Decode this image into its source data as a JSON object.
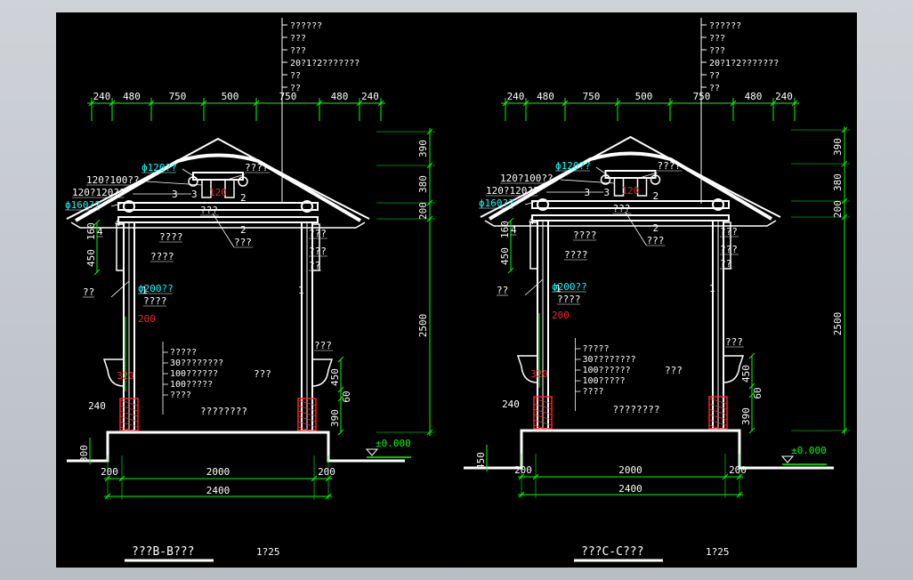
{
  "colors": {
    "background": "#000000",
    "frame": "#c4c8cd",
    "line": "#ffffff",
    "dimension": "#00ff00",
    "dim_text": "#ffffff",
    "red": "#ff2020",
    "cyan": "#00ffff",
    "yellow": "#ffff00"
  },
  "left": {
    "title": "???B-B???",
    "scale": "1?25",
    "top_dims": [
      "240",
      "480",
      "750",
      "500",
      "750",
      "480",
      "240"
    ],
    "bottom_dims": [
      "200",
      "2000",
      "200"
    ],
    "bottom_total": "2400",
    "right_dims": [
      "390",
      "380",
      "200",
      "2500"
    ],
    "left_dims": [
      "450",
      "160",
      "300",
      "240",
      "320"
    ],
    "mid_dims": [
      "200"
    ],
    "elev": "±0.000",
    "roof_notes": [
      "??????",
      "???",
      "???",
      "20?1?2???????",
      "??",
      "??"
    ],
    "labels_left": [
      "ϕ120??",
      "120?100??",
      "120?120??",
      "ϕ160??",
      "4",
      "????",
      "????",
      "??",
      "ϕ200??",
      "????"
    ],
    "labels_right": [
      "????",
      "???",
      "???",
      "???",
      "??",
      "???",
      "???"
    ],
    "labels_center": [
      "3",
      "3",
      "120",
      "2",
      "2",
      "1",
      "1",
      "4"
    ],
    "base_notes": [
      "?????",
      "30????????",
      "100??????",
      "100?????",
      "????"
    ],
    "base_right_labels": [
      "???",
      "????????"
    ],
    "base_right_dims": [
      "450",
      "60",
      "390"
    ]
  },
  "right": {
    "title": "???C-C???",
    "scale": "1?25",
    "top_dims": [
      "240",
      "480",
      "750",
      "500",
      "750",
      "480",
      "240"
    ],
    "bottom_dims": [
      "200",
      "2000",
      "200"
    ],
    "bottom_total": "2400",
    "right_dims": [
      "390",
      "380",
      "200",
      "2500"
    ],
    "left_dims": [
      "450",
      "160",
      "450",
      "240",
      "320"
    ],
    "mid_dims": [
      "200"
    ],
    "elev": "±0.000",
    "roof_notes": [
      "??????",
      "???",
      "???",
      "20?1?2???????",
      "??",
      "??"
    ],
    "labels_left": [
      "ϕ120??",
      "120?100??",
      "120?120??",
      "ϕ160??",
      "4",
      "????",
      "????",
      "??",
      "ϕ200??",
      "????"
    ],
    "labels_right": [
      "????",
      "???",
      "???",
      "???",
      "??",
      "???",
      "???"
    ],
    "labels_center": [
      "3",
      "3",
      "120",
      "2",
      "2",
      "1",
      "1",
      "4"
    ],
    "base_notes": [
      "?????",
      "30????????",
      "100??????",
      "100?????",
      "????"
    ],
    "base_right_labels": [
      "???",
      "????????"
    ],
    "base_right_dims": [
      "450",
      "60",
      "390"
    ]
  }
}
